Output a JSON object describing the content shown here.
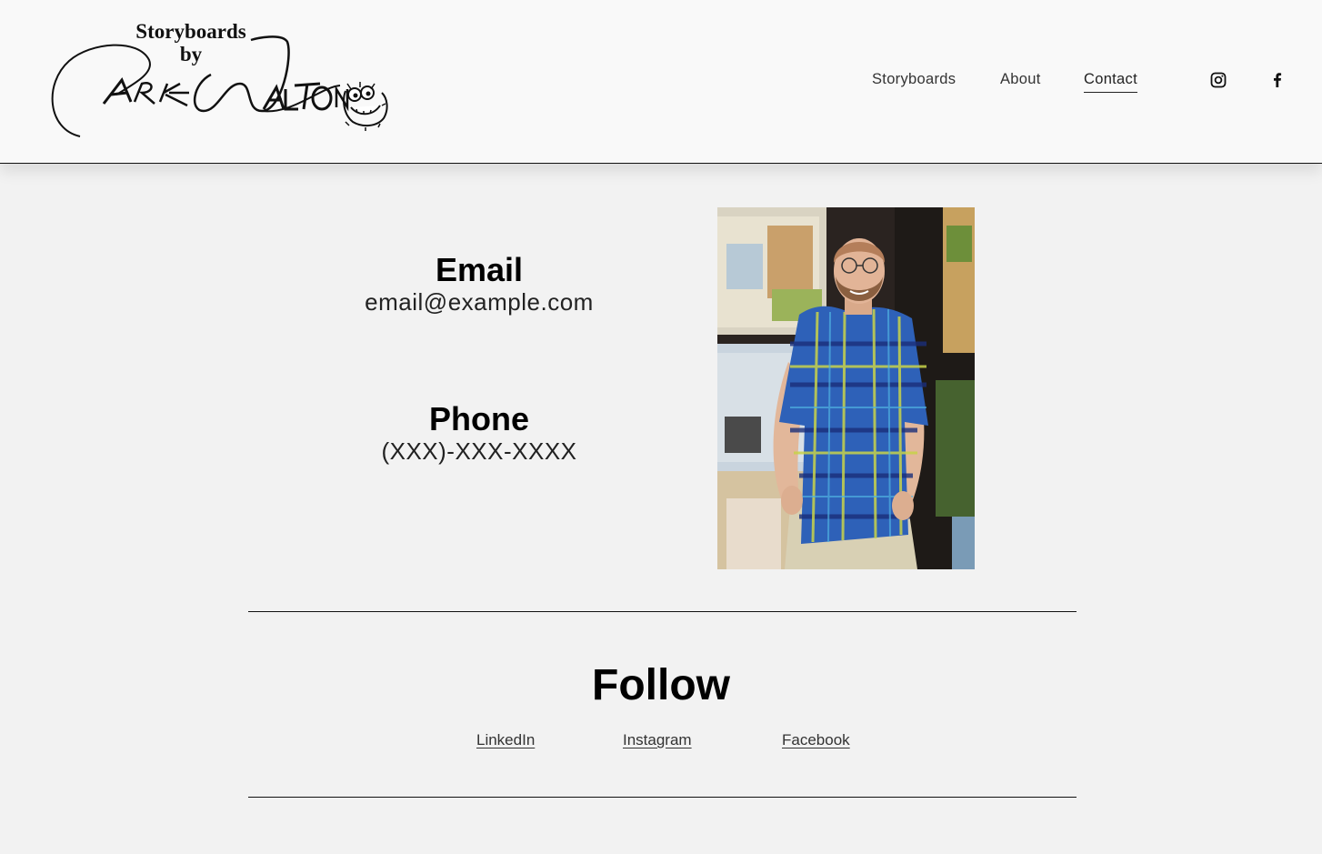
{
  "logo": {
    "text_top": "Storyboards",
    "text_by": "by"
  },
  "nav": {
    "items": [
      {
        "label": "Storyboards",
        "active": false
      },
      {
        "label": "About",
        "active": false
      },
      {
        "label": "Contact",
        "active": true
      }
    ]
  },
  "header_social": [
    {
      "icon": "instagram-icon"
    },
    {
      "icon": "facebook-icon"
    }
  ],
  "contact": {
    "email_heading": "Email",
    "email_value": "email@example.com",
    "phone_heading": "Phone",
    "phone_value": "(XXX)-XXX-XXXX"
  },
  "follow": {
    "title": "Follow",
    "links": [
      {
        "label": "LinkedIn"
      },
      {
        "label": "Instagram"
      },
      {
        "label": "Facebook"
      }
    ]
  }
}
